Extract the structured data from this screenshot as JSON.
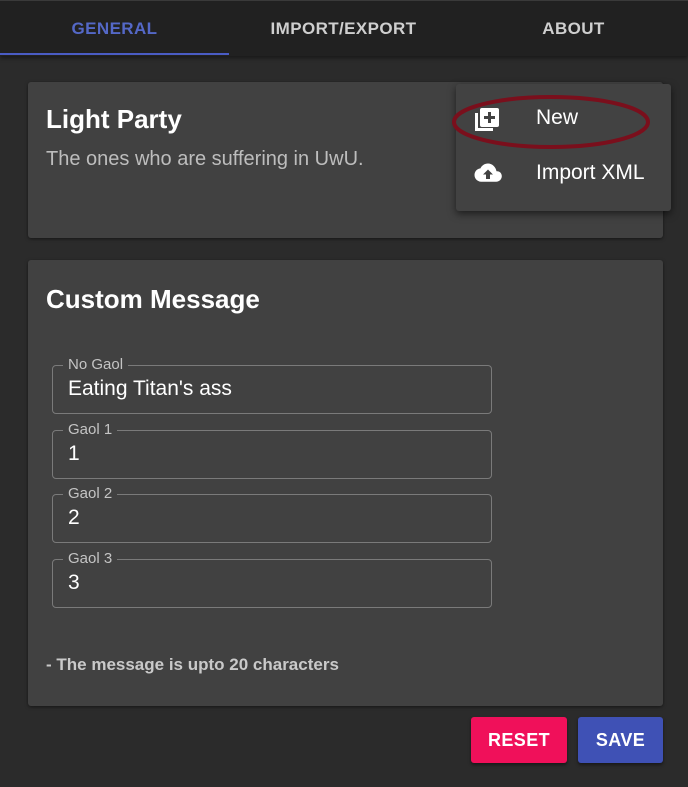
{
  "tabs": [
    {
      "label": "GENERAL",
      "active": true
    },
    {
      "label": "IMPORT/EXPORT",
      "active": false
    },
    {
      "label": "ABOUT",
      "active": false
    }
  ],
  "party": {
    "title": "Light Party",
    "description": "The ones who are suffering in UwU."
  },
  "custom_message": {
    "title": "Custom Message",
    "fields": [
      {
        "label": "No Gaol",
        "value": "Eating Titan's ass"
      },
      {
        "label": "Gaol 1",
        "value": "1"
      },
      {
        "label": "Gaol 2",
        "value": "2"
      },
      {
        "label": "Gaol 3",
        "value": "3"
      }
    ],
    "hint": "- The message is upto 20 characters"
  },
  "buttons": {
    "reset": "RESET",
    "save": "SAVE"
  },
  "menu": {
    "items": [
      {
        "label": "New",
        "icon": "add-box-icon"
      },
      {
        "label": "Import XML",
        "icon": "cloud-upload-icon"
      }
    ]
  },
  "colors": {
    "accent": "#3f51b5",
    "reset": "#f0105a",
    "annotation": "#7a0f1c"
  }
}
